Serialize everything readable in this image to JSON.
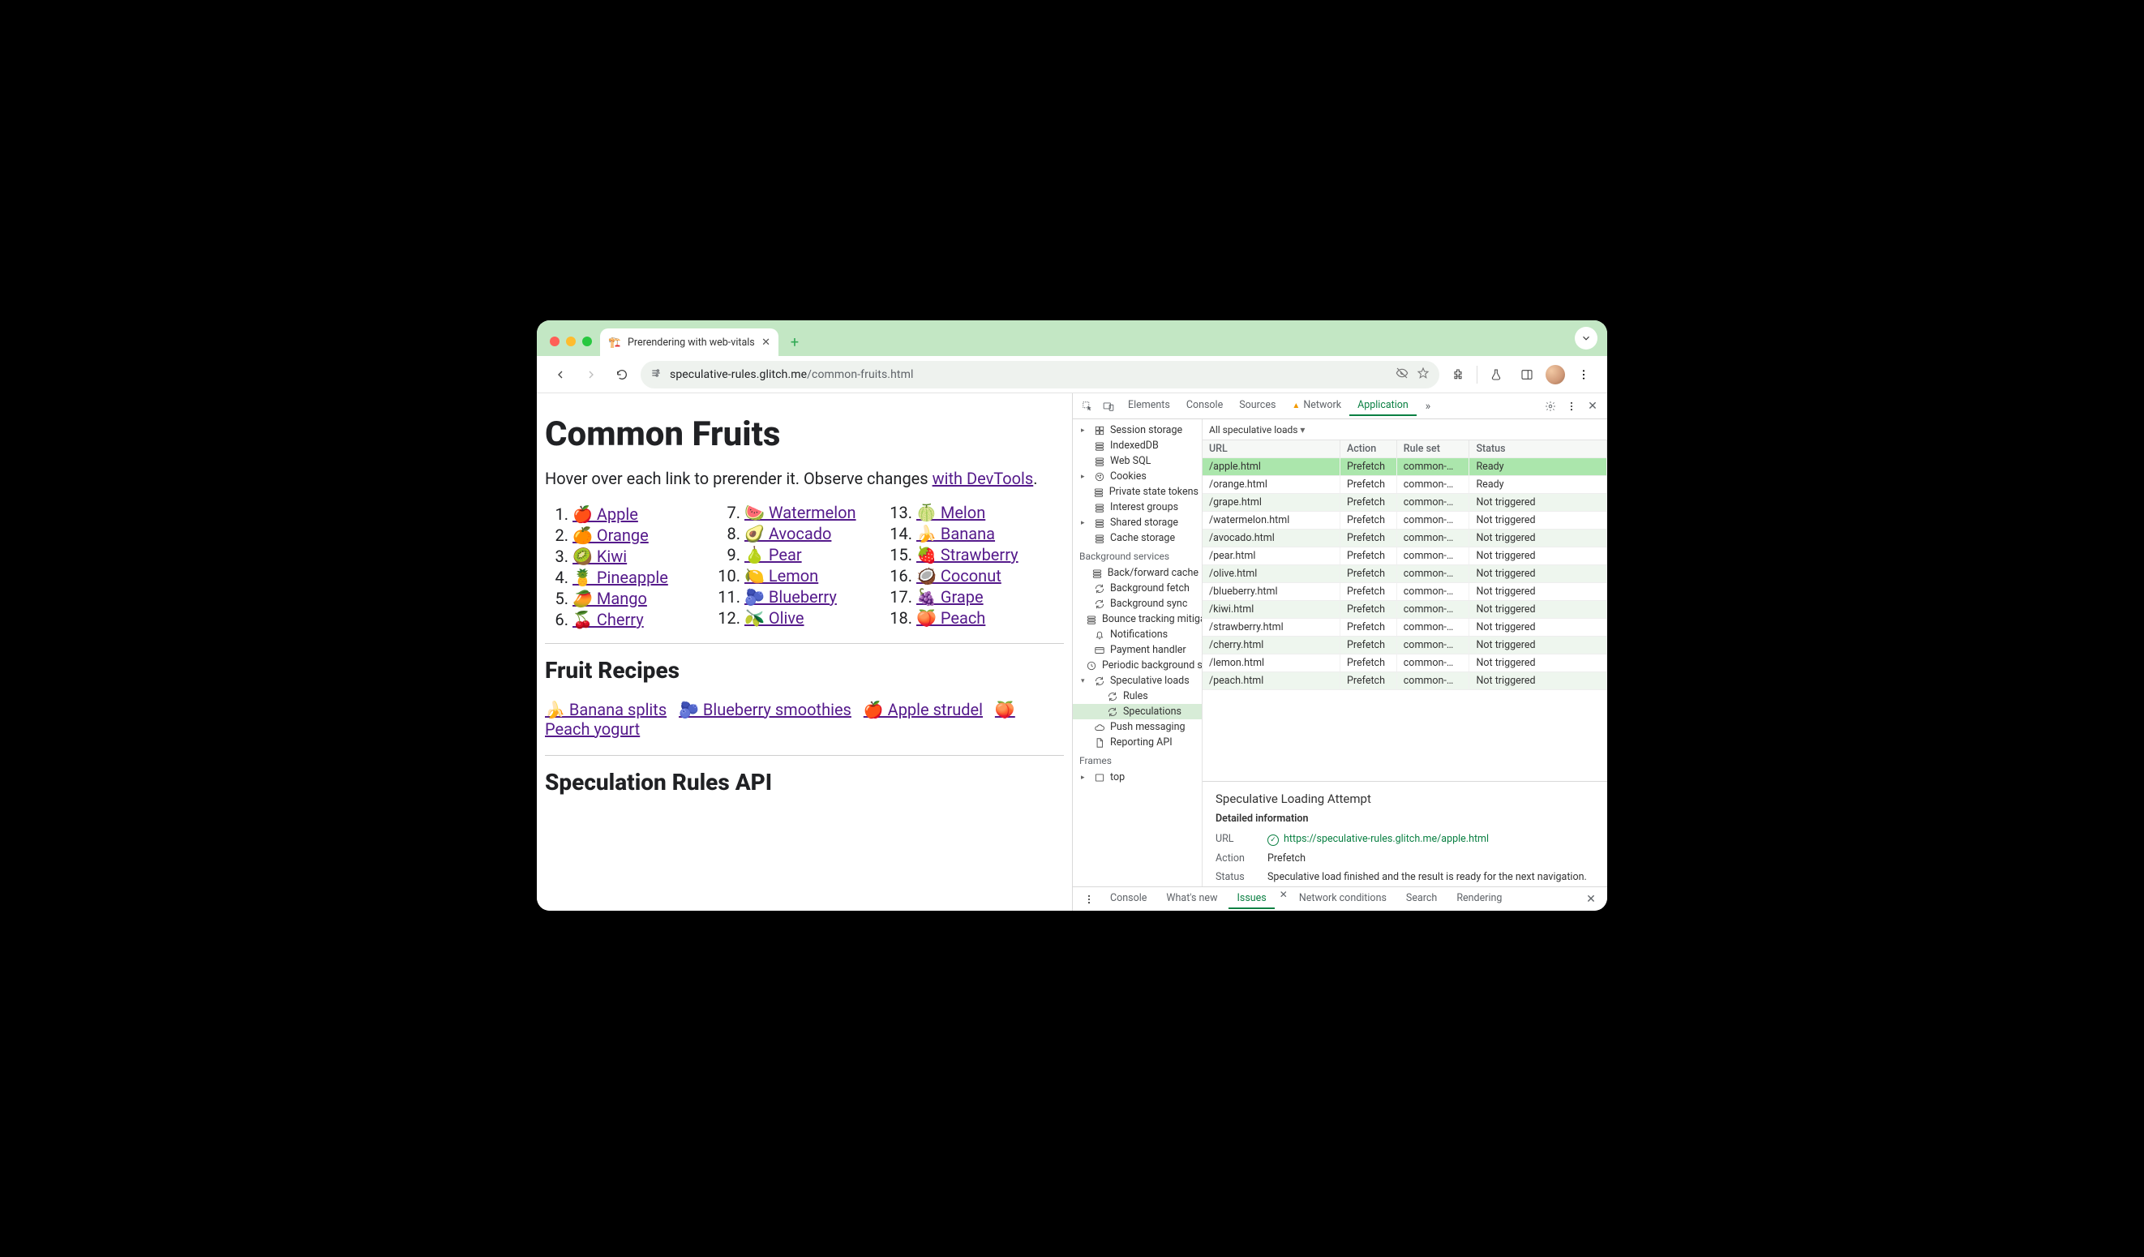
{
  "window": {
    "tab_title": "Prerendering with web-vitals",
    "tab_favicon": "🍎",
    "url_host": "speculative-rules.glitch.me",
    "url_path": "/common-fruits.html"
  },
  "page": {
    "h1": "Common Fruits",
    "lead_text": "Hover over each link to prerender it. Observe changes ",
    "lead_link": "with DevTools",
    "lead_tail": ".",
    "fruits": [
      {
        "emoji": "🍎",
        "label": "Apple"
      },
      {
        "emoji": "🍊",
        "label": "Orange"
      },
      {
        "emoji": "🥝",
        "label": "Kiwi"
      },
      {
        "emoji": "🍍",
        "label": "Pineapple"
      },
      {
        "emoji": "🥭",
        "label": "Mango"
      },
      {
        "emoji": "🍒",
        "label": "Cherry"
      },
      {
        "emoji": "🍉",
        "label": "Watermelon"
      },
      {
        "emoji": "🥑",
        "label": "Avocado"
      },
      {
        "emoji": "🍐",
        "label": "Pear"
      },
      {
        "emoji": "🍋",
        "label": "Lemon"
      },
      {
        "emoji": "🫐",
        "label": "Blueberry"
      },
      {
        "emoji": "🫒",
        "label": "Olive"
      },
      {
        "emoji": "🍈",
        "label": "Melon"
      },
      {
        "emoji": "🍌",
        "label": "Banana"
      },
      {
        "emoji": "🍓",
        "label": "Strawberry"
      },
      {
        "emoji": "🥥",
        "label": "Coconut"
      },
      {
        "emoji": "🍇",
        "label": "Grape"
      },
      {
        "emoji": "🍑",
        "label": "Peach"
      }
    ],
    "recipes_h2": "Fruit Recipes",
    "recipes": [
      {
        "emoji": "🍌",
        "label": "Banana splits"
      },
      {
        "emoji": "🫐",
        "label": "Blueberry smoothies"
      },
      {
        "emoji": "🍎",
        "label": "Apple strudel"
      },
      {
        "emoji": "🍑",
        "label": "Peach yogurt"
      }
    ],
    "api_h2": "Speculation Rules API"
  },
  "devtools": {
    "tabs": [
      "Elements",
      "Console",
      "Sources",
      "Network",
      "Application"
    ],
    "network_warn": true,
    "active_tab": "Application",
    "more_tabs_icon": "»",
    "sidebar": {
      "top": [
        {
          "label": "Session storage",
          "icon": "grid",
          "expand": "▸"
        },
        {
          "label": "IndexedDB",
          "icon": "db"
        },
        {
          "label": "Web SQL",
          "icon": "db"
        },
        {
          "label": "Cookies",
          "icon": "cookie",
          "expand": "▸"
        },
        {
          "label": "Private state tokens",
          "icon": "db"
        },
        {
          "label": "Interest groups",
          "icon": "db"
        },
        {
          "label": "Shared storage",
          "icon": "db",
          "expand": "▸"
        },
        {
          "label": "Cache storage",
          "icon": "db"
        }
      ],
      "bg_header": "Background services",
      "bg": [
        {
          "label": "Back/forward cache",
          "icon": "db"
        },
        {
          "label": "Background fetch",
          "icon": "sync"
        },
        {
          "label": "Background sync",
          "icon": "sync"
        },
        {
          "label": "Bounce tracking mitigations",
          "icon": "db"
        },
        {
          "label": "Notifications",
          "icon": "bell"
        },
        {
          "label": "Payment handler",
          "icon": "card"
        },
        {
          "label": "Periodic background sync",
          "icon": "clock"
        },
        {
          "label": "Speculative loads",
          "icon": "sync",
          "expand": "▾",
          "children": [
            {
              "label": "Rules",
              "icon": "sync"
            },
            {
              "label": "Speculations",
              "icon": "sync",
              "selected": true
            }
          ]
        },
        {
          "label": "Push messaging",
          "icon": "cloud"
        },
        {
          "label": "Reporting API",
          "icon": "doc"
        }
      ],
      "frames_header": "Frames",
      "frames": [
        {
          "label": "top",
          "icon": "frame",
          "expand": "▸"
        }
      ]
    },
    "filter_label": "All speculative loads",
    "columns": [
      "URL",
      "Action",
      "Rule set",
      "Status"
    ],
    "rows": [
      {
        "url": "/apple.html",
        "action": "Prefetch",
        "ruleset": "common-…",
        "status": "Ready",
        "selected": true
      },
      {
        "url": "/orange.html",
        "action": "Prefetch",
        "ruleset": "common-…",
        "status": "Ready"
      },
      {
        "url": "/grape.html",
        "action": "Prefetch",
        "ruleset": "common-…",
        "status": "Not triggered"
      },
      {
        "url": "/watermelon.html",
        "action": "Prefetch",
        "ruleset": "common-…",
        "status": "Not triggered"
      },
      {
        "url": "/avocado.html",
        "action": "Prefetch",
        "ruleset": "common-…",
        "status": "Not triggered"
      },
      {
        "url": "/pear.html",
        "action": "Prefetch",
        "ruleset": "common-…",
        "status": "Not triggered"
      },
      {
        "url": "/olive.html",
        "action": "Prefetch",
        "ruleset": "common-…",
        "status": "Not triggered"
      },
      {
        "url": "/blueberry.html",
        "action": "Prefetch",
        "ruleset": "common-…",
        "status": "Not triggered"
      },
      {
        "url": "/kiwi.html",
        "action": "Prefetch",
        "ruleset": "common-…",
        "status": "Not triggered"
      },
      {
        "url": "/strawberry.html",
        "action": "Prefetch",
        "ruleset": "common-…",
        "status": "Not triggered"
      },
      {
        "url": "/cherry.html",
        "action": "Prefetch",
        "ruleset": "common-…",
        "status": "Not triggered"
      },
      {
        "url": "/lemon.html",
        "action": "Prefetch",
        "ruleset": "common-…",
        "status": "Not triggered"
      },
      {
        "url": "/peach.html",
        "action": "Prefetch",
        "ruleset": "common-…",
        "status": "Not triggered"
      }
    ],
    "detail": {
      "title": "Speculative Loading Attempt",
      "section": "Detailed information",
      "url_label": "URL",
      "url_value": "https://speculative-rules.glitch.me/apple.html",
      "action_label": "Action",
      "action_value": "Prefetch",
      "status_label": "Status",
      "status_value": "Speculative load finished and the result is ready for the next navigation."
    },
    "drawer": [
      "Console",
      "What's new",
      "Issues",
      "Network conditions",
      "Search",
      "Rendering"
    ],
    "drawer_active": "Issues"
  }
}
